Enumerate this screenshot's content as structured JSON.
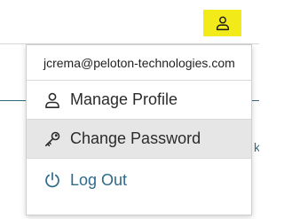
{
  "header": {
    "profile_button_icon": "person-icon"
  },
  "background": {
    "partial_text": "k"
  },
  "menu": {
    "email": "jcrema@peloton-technologies.com",
    "items": [
      {
        "label": "Manage Profile",
        "icon": "person-icon"
      },
      {
        "label": "Change Password",
        "icon": "key-icon"
      },
      {
        "label": "Log Out",
        "icon": "power-icon"
      }
    ]
  },
  "colors": {
    "profile_button_bg": "#f2ea19",
    "logout_text": "#2e6a8a",
    "hover_bg": "#e6e6e6"
  }
}
